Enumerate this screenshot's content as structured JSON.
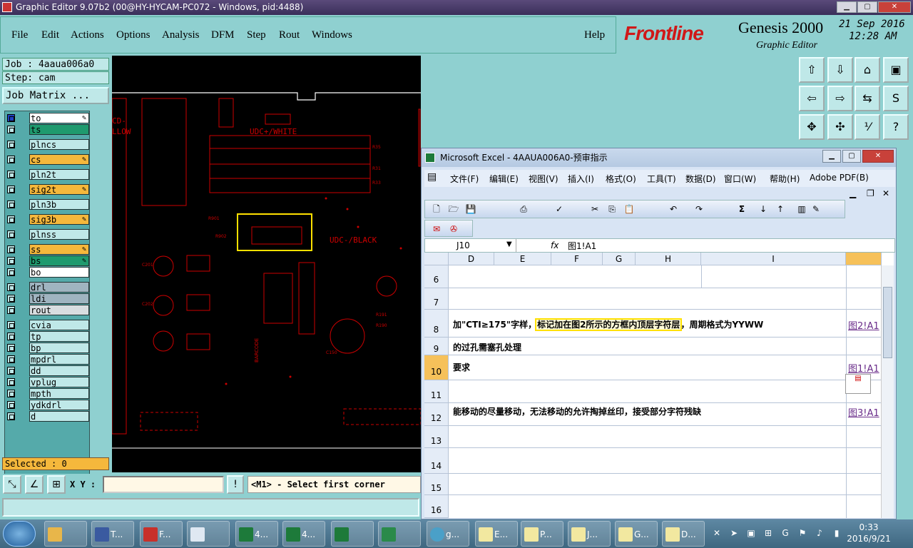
{
  "ge_window": {
    "title": "Graphic Editor 9.07b2 (00@HY-HYCAM-PC072 - Windows, pid:4488)",
    "menu": [
      "File",
      "Edit",
      "Actions",
      "Options",
      "Analysis",
      "DFM",
      "Step",
      "Rout",
      "Windows"
    ],
    "help": "Help",
    "brand": "Frontline",
    "product": "Genesis 2000",
    "product_sub": "Graphic Editor",
    "date": "21 Sep 2016",
    "time": "12:28 AM"
  },
  "left_panel": {
    "job": "Job : 4aaua006a0",
    "step": "Step: cam",
    "job_matrix": "Job Matrix ...",
    "layers": [
      {
        "name": "to",
        "color": "#ffffff",
        "flag": "✎"
      },
      {
        "name": "ts",
        "color": "#1f9a6e",
        "flag": ""
      },
      {
        "name": "plncs",
        "color": "#bfe8e8",
        "flag": ""
      },
      {
        "name": "cs",
        "color": "#f5b83c",
        "flag": "✎"
      },
      {
        "name": "pln2t",
        "color": "#bfe8e8",
        "flag": ""
      },
      {
        "name": "sig2t",
        "color": "#f5b83c",
        "flag": "✎"
      },
      {
        "name": "pln3b",
        "color": "#bfe8e8",
        "flag": ""
      },
      {
        "name": "sig3b",
        "color": "#f5b83c",
        "flag": "✎"
      },
      {
        "name": "plnss",
        "color": "#bfe8e8",
        "flag": ""
      },
      {
        "name": "ss",
        "color": "#f5b83c",
        "flag": "✎"
      },
      {
        "name": "bs",
        "color": "#1f9a6e",
        "flag": "✎"
      },
      {
        "name": "bo",
        "color": "#ffffff",
        "flag": ""
      },
      {
        "name": "drl",
        "color": "#9fb4c0",
        "flag": ""
      },
      {
        "name": "ldi",
        "color": "#9fb4c0",
        "flag": ""
      },
      {
        "name": "rout",
        "color": "#d8dde0",
        "flag": ""
      },
      {
        "name": "cvia",
        "color": "#bfe8e8",
        "flag": ""
      },
      {
        "name": "tp",
        "color": "#bfe8e8",
        "flag": ""
      },
      {
        "name": "bp",
        "color": "#bfe8e8",
        "flag": ""
      },
      {
        "name": "mpdrl",
        "color": "#bfe8e8",
        "flag": ""
      },
      {
        "name": "dd",
        "color": "#bfe8e8",
        "flag": ""
      },
      {
        "name": "vplug",
        "color": "#bfe8e8",
        "flag": ""
      },
      {
        "name": "mpth",
        "color": "#bfe8e8",
        "flag": ""
      },
      {
        "name": "ydkdrl",
        "color": "#bfe8e8",
        "flag": ""
      },
      {
        "name": "d",
        "color": "#bfe8e8",
        "flag": ""
      }
    ],
    "selected": "Selected : 0"
  },
  "canvas": {
    "labels": [
      "UDC+/WHITE",
      "UDC-/BLACK",
      "CD-",
      "LLOW",
      "BARCODE",
      "R35",
      "R31",
      "R33",
      "C201",
      "C202",
      "R901",
      "R902",
      "C150",
      "R191",
      "R190"
    ]
  },
  "bottom_bar": {
    "xy_label": "X Y :",
    "xy_value": "",
    "message": "<M1> - Select first corner"
  },
  "excel": {
    "title": "Microsoft Excel - 4AAUA006A0-预审指示",
    "menu": [
      "文件(F)",
      "编辑(E)",
      "视图(V)",
      "插入(I)",
      "格式(O)",
      "工具(T)",
      "数据(D)",
      "窗口(W)",
      "帮助(H)",
      "Adobe PDF(B)"
    ],
    "name_box": "J10",
    "fx": "fx",
    "formula": "图1!A1",
    "columns": [
      "D",
      "E",
      "F",
      "G",
      "H",
      "I"
    ],
    "rows": [
      "6",
      "7",
      "8",
      "9",
      "10",
      "11",
      "12",
      "13",
      "14",
      "15",
      "16"
    ],
    "cells": {
      "r8": "加\"CTI≥175\"字样，",
      "r8_hl": "标记加在图2所示的方框内顶层字符层",
      "r8_tail": "，周期格式为YYWW",
      "r9": "的过孔需塞孔处理",
      "r10": "要求",
      "r12": "能移动的尽量移动，无法移动的允许掏掉丝印，接受部分字符残缺"
    },
    "links": {
      "r8": "图2!A1",
      "r10": "图1!A1",
      "r12": "图3!A1"
    }
  },
  "taskbar": {
    "items": [
      "T...",
      "F...",
      "4...",
      "4...",
      "g...",
      "E...",
      "P...",
      "J...",
      "G...",
      "D..."
    ],
    "time": "0:33",
    "date": "2016/9/21"
  }
}
